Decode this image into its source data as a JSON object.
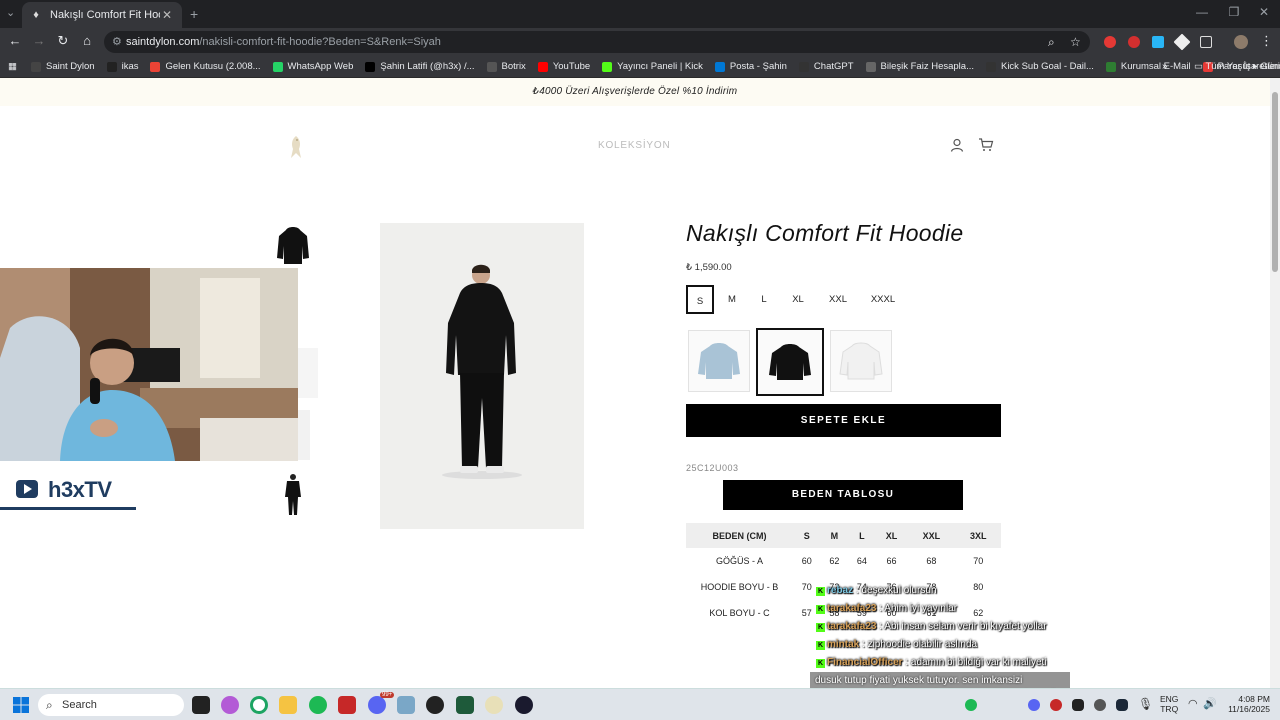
{
  "browser": {
    "tab_title": "Nakışlı Comfort Fit Hoodie",
    "url_host": "saintdylon.com",
    "url_path": "/nakisli-comfort-fit-hoodie?Beden=S&Renk=Siyah",
    "bookmarks": [
      {
        "label": "Saint Dylon",
        "color": "#444"
      },
      {
        "label": "ikas",
        "color": "#222"
      },
      {
        "label": "Gelen Kutusu (2.008...",
        "color": "#ea4335"
      },
      {
        "label": "WhatsApp Web",
        "color": "#25d366"
      },
      {
        "label": "Şahin Latifi (@h3x) /...",
        "color": "#000"
      },
      {
        "label": "Botrix",
        "color": "#555"
      },
      {
        "label": "YouTube",
        "color": "#ff0000"
      },
      {
        "label": "Yayıncı Paneli | Kick",
        "color": "#53fc18"
      },
      {
        "label": "Posta - Şahin",
        "color": "#0078d4"
      },
      {
        "label": "ChatGPT",
        "color": "#333"
      },
      {
        "label": "Bileşik Faiz Hesapla...",
        "color": "#666"
      },
      {
        "label": "Kick Sub Goal - Dail...",
        "color": "#333"
      },
      {
        "label": "Kurumsal E-Mail",
        "color": "#2e7d32"
      },
      {
        "label": "Paraşüt ▸ Güncel D...",
        "color": "#e53935"
      }
    ],
    "bookmarks_more": "»",
    "all_bookmarks": "Tüm Yer İşaretleri"
  },
  "site": {
    "announcement": "₺4000 Üzeri Alışverişlerde Özel %10 İndirim",
    "nav_collection": "KOLEKSİYON"
  },
  "product": {
    "title": "Nakışlı Comfort Fit Hoodie",
    "price": "₺ 1,590.00",
    "sizes": [
      "S",
      "M",
      "L",
      "XL",
      "XXL",
      "XXXL"
    ],
    "selected_size": "S",
    "colors": [
      {
        "name": "light blue",
        "hex": "#a9c3d6"
      },
      {
        "name": "black",
        "hex": "#111111"
      },
      {
        "name": "white",
        "hex": "#f1f1f1"
      }
    ],
    "selected_color": "black",
    "add_to_cart": "SEPETE EKLE",
    "sku": "25C12U003",
    "size_chart_button": "BEDEN TABLOSU"
  },
  "size_table": {
    "headers": [
      "BEDEN (CM)",
      "S",
      "M",
      "L",
      "XL",
      "XXL",
      "3XL"
    ],
    "rows": [
      [
        "GÖĞÜS - A",
        "60",
        "62",
        "64",
        "66",
        "68",
        "70"
      ],
      [
        "HOODIE BOYU - B",
        "70",
        "72",
        "74",
        "76",
        "78",
        "80"
      ],
      [
        "KOL BOYU - C",
        "57",
        "58",
        "59",
        "60",
        "61",
        "62"
      ]
    ]
  },
  "stream": {
    "brand": "h3xTV",
    "chat": [
      {
        "user": "rebaz",
        "msg": " : deşexkul olursun",
        "color": "#7ec8e3"
      },
      {
        "user": "tarakafa23",
        "msg": " : Ahim iyi yayınlar",
        "color": "#d8a25a"
      },
      {
        "user": "tarakafa23",
        "msg": " : Abi insan selam verir bi kıyafet yollar",
        "color": "#d8a25a"
      },
      {
        "user": "mintak",
        "msg": " : ziphoodie olabilir aslında",
        "color": "#d8a25a"
      },
      {
        "user": "FinancialOfficer",
        "msg": " : adamın bi bildiği var ki maliyeti",
        "color": "#d8a25a"
      }
    ],
    "chat_last": "dusuk tutup fiyati yuksek tutuyor. sen imkansizi istiyorsun. cok pahaliya mal edip en uyguna satip nasil kar edeceksin"
  },
  "taskbar": {
    "search": "Search",
    "lang_top": "ENG",
    "lang_bottom": "TRQ",
    "time": "4:08 PM",
    "date": "11/16/2025",
    "notif_badge": "99+"
  }
}
